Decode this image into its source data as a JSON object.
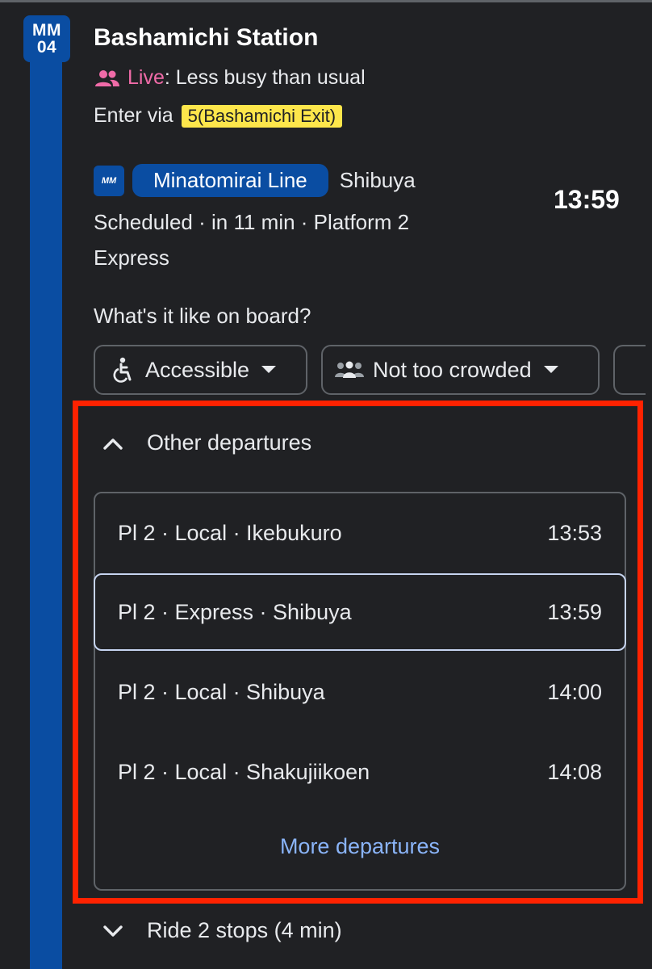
{
  "station": {
    "code_line1": "MM",
    "code_line2": "04",
    "name": "Bashamichi Station",
    "live_label": "Live",
    "live_text": ": Less busy than usual",
    "enter_text": "Enter via",
    "exit_label": "5(Bashamichi Exit)"
  },
  "departure": {
    "line_logo": "MM",
    "line_name": "Minatomirai Line",
    "destination": "Shibuya",
    "time": "13:59",
    "status": "Scheduled · in 11 min · Platform 2",
    "type": "Express"
  },
  "onboard": {
    "question": "What's it like on board?",
    "chips": [
      {
        "label": "Accessible",
        "icon": "accessible-icon"
      },
      {
        "label": "Not too crowded",
        "icon": "people-group-icon"
      }
    ]
  },
  "other_departures": {
    "title": "Other departures",
    "rows": [
      {
        "label": "Pl 2 · Local · Ikebukuro",
        "time": "13:53",
        "selected": false
      },
      {
        "label": "Pl 2 · Express · Shibuya",
        "time": "13:59",
        "selected": true
      },
      {
        "label": "Pl 2 · Local · Shibuya",
        "time": "14:00",
        "selected": false
      },
      {
        "label": "Pl 2 · Local · Shakujiikoen",
        "time": "14:08",
        "selected": false
      }
    ],
    "more_label": "More departures"
  },
  "ride": {
    "label": "Ride 2 stops (4 min)"
  },
  "colors": {
    "background": "#202124",
    "line_blue": "#0a4da2",
    "live_pink": "#f06ba8",
    "exit_yellow": "#fde64b",
    "link_blue": "#8ab4f8",
    "highlight_red": "#ff2200"
  }
}
